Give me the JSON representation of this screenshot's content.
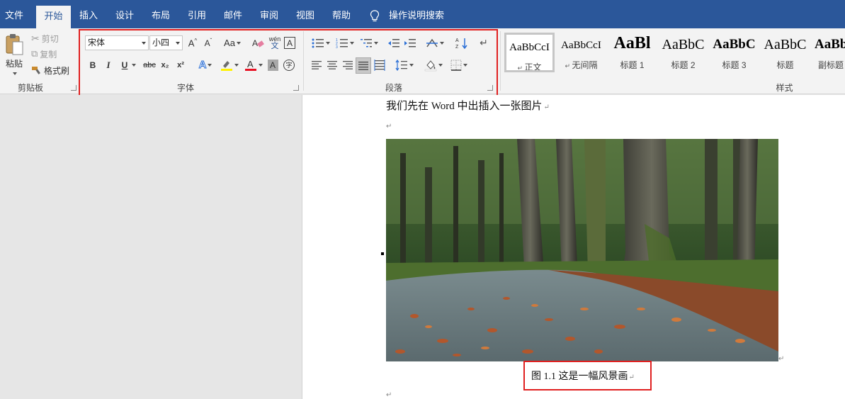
{
  "tabs": [
    {
      "label": "文件"
    },
    {
      "label": "开始"
    },
    {
      "label": "插入"
    },
    {
      "label": "设计"
    },
    {
      "label": "布局"
    },
    {
      "label": "引用"
    },
    {
      "label": "邮件"
    },
    {
      "label": "审阅"
    },
    {
      "label": "视图"
    },
    {
      "label": "帮助"
    }
  ],
  "active_tab": "开始",
  "tell_me": {
    "label": "操作说明搜索",
    "icon": "lightbulb-icon"
  },
  "clipboard": {
    "paste_label": "粘贴",
    "cut_label": "剪切",
    "copy_label": "复制",
    "format_painter_label": "格式刷",
    "group_label": "剪贴板"
  },
  "font": {
    "font_name": "宋体",
    "font_size": "小四",
    "change_case_label": "Aa",
    "phonetic_label": "wén",
    "phonetic_sub": "文",
    "bold_label": "B",
    "italic_label": "I",
    "underline_label": "U",
    "strike_label": "abc",
    "sub_label": "x₂",
    "sup_label": "x²",
    "group_label": "字体",
    "font_color": "#e81123",
    "highlight_color": "#fff200"
  },
  "paragraph": {
    "group_label": "段落"
  },
  "styles": {
    "group_label": "样式",
    "items": [
      {
        "sample": "AaBbCcI",
        "name": "正文",
        "selected": true
      },
      {
        "sample": "AaBbCcI",
        "name": "无间隔"
      },
      {
        "sample": "AaBl",
        "name": "标题 1"
      },
      {
        "sample": "AaBbC",
        "name": "标题 2"
      },
      {
        "sample": "AaBbC",
        "name": "标题 3"
      },
      {
        "sample": "AaBbC",
        "name": "标题"
      },
      {
        "sample": "AaBb",
        "name": "副标题"
      }
    ]
  },
  "document": {
    "line1": "我们先在 Word 中出插入一张图片",
    "caption": "图 1.1  这是一幅风景画",
    "para_mark": "↵"
  },
  "colors": {
    "brand": "#2b579a",
    "highlight_box": "#e02020"
  }
}
